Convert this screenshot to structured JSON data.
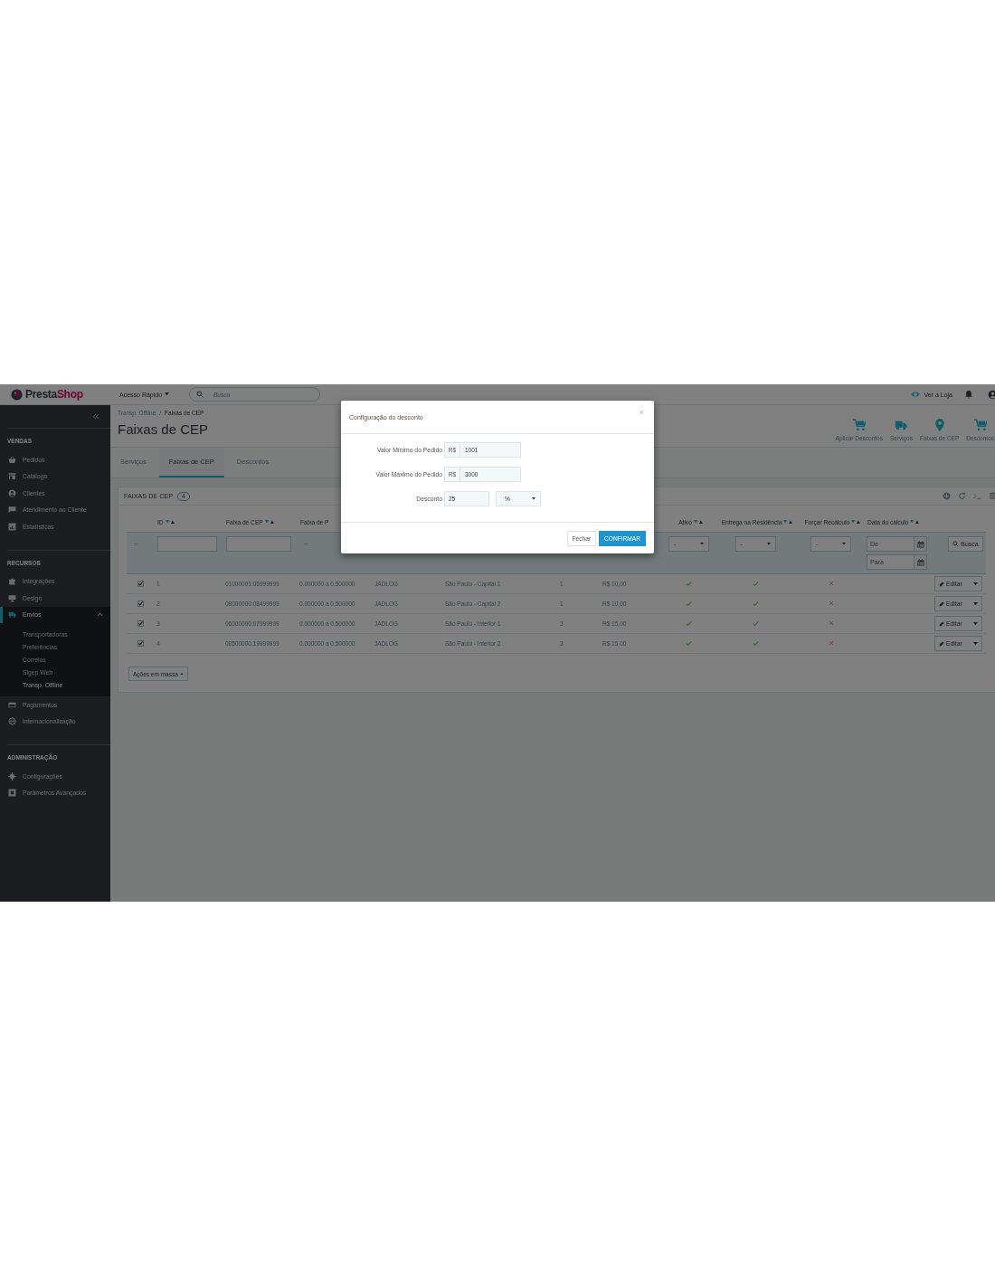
{
  "header": {
    "logo": {
      "first": "Presta",
      "second": "Shop"
    },
    "quick_access": "Acesso Rápido",
    "search": {
      "placeholder": "Busca"
    },
    "store_link": "Ver a Loja"
  },
  "sidebar": {
    "sections": [
      {
        "title": "VENDAS",
        "items": [
          {
            "label": "Pedidos",
            "selected": false,
            "expanded": false
          },
          {
            "label": "Catálogo",
            "selected": false,
            "expanded": false
          },
          {
            "label": "Clientes",
            "selected": false,
            "expanded": false
          },
          {
            "label": "Atendimento ao Cliente",
            "selected": false,
            "expanded": false
          },
          {
            "label": "Estatísticas",
            "selected": false,
            "expanded": false
          }
        ]
      },
      {
        "title": "RECURSOS",
        "items": [
          {
            "label": "Integrações",
            "selected": false,
            "expanded": false
          },
          {
            "label": "Design",
            "selected": false,
            "expanded": false
          },
          {
            "label": "Envios",
            "selected": true,
            "expanded": true,
            "children": [
              {
                "label": "Transportadoras",
                "selected": false
              },
              {
                "label": "Preferências",
                "selected": false
              },
              {
                "label": "Correios",
                "selected": false
              },
              {
                "label": "Sigep Web",
                "selected": false
              },
              {
                "label": "Transp. Offline",
                "selected": true
              }
            ]
          },
          {
            "label": "Pagamentos",
            "selected": false,
            "expanded": false
          },
          {
            "label": "Internacionalização",
            "selected": false,
            "expanded": false
          }
        ]
      },
      {
        "title": "ADMINISTRAÇÃO",
        "items": [
          {
            "label": "Configurações",
            "selected": false,
            "expanded": false
          },
          {
            "label": "Parâmetros Avançados",
            "selected": false,
            "expanded": false
          }
        ]
      }
    ]
  },
  "page": {
    "breadcrumb": {
      "items": [
        "Transp. Offline",
        "Faixas de CEP"
      ],
      "separator": "/"
    },
    "title": "Faixas de CEP",
    "toolbar": [
      "Aplicar Descontos",
      "Serviços",
      "Faixas de CEP",
      "Descontos"
    ],
    "tabs": [
      {
        "label": "Serviços",
        "selected": false
      },
      {
        "label": "Faixas de CEP",
        "selected": true
      },
      {
        "label": "Descontos",
        "selected": false
      }
    ]
  },
  "panel": {
    "title": "FAIXAS DE CEP",
    "count": "4",
    "selection": {
      "filter": {
        "kind": "text",
        "text": "--"
      }
    },
    "columns": [
      {
        "kind": "text",
        "label": "ID",
        "sortable": true,
        "filter": {
          "kind": "input"
        }
      },
      {
        "kind": "text",
        "label": "Faixa de CEP",
        "sortable": true,
        "filter": {
          "kind": "input"
        }
      },
      {
        "kind": "text",
        "label": "Faixa de P",
        "sortable": false,
        "filter": {
          "kind": "text",
          "text": "--"
        }
      },
      {
        "kind": "text"
      },
      {
        "kind": "text"
      },
      {
        "kind": "text"
      },
      {
        "kind": "text"
      },
      {
        "kind": "flag",
        "label": "Ativo",
        "sortable": true,
        "filter": {
          "kind": "select",
          "value": "-"
        }
      },
      {
        "kind": "flag",
        "label": "Entrega na Residência",
        "sortable": true,
        "filter": {
          "kind": "select",
          "value": "-"
        }
      },
      {
        "kind": "flag",
        "label": "Forçar Recálculo",
        "sortable": true,
        "filter": {
          "kind": "select",
          "value": "-"
        }
      },
      {
        "kind": "date",
        "label": "Data do cálculo",
        "sortable": true,
        "filter": {
          "kind": "date_range",
          "from_placeholder": "De",
          "to_placeholder": "Para"
        }
      },
      {
        "kind": "actions",
        "filter": {
          "kind": "button",
          "label": "Busca"
        }
      }
    ],
    "rows": [
      {
        "checked": true,
        "cells": [
          "1",
          "01000001:05999999",
          "0.000000 a 0.500000",
          "JADLOG",
          "São Paulo - Capital 1",
          "1",
          "R$ 10,00"
        ],
        "flags": [
          true,
          true,
          false
        ],
        "action": "Editar"
      },
      {
        "checked": true,
        "cells": [
          "2",
          "08000000:08499999",
          "0.000000 a 0.500000",
          "JADLOG",
          "São Paulo - Capital 2",
          "1",
          "R$ 10,00"
        ],
        "flags": [
          true,
          true,
          false
        ],
        "action": "Editar"
      },
      {
        "checked": true,
        "cells": [
          "3",
          "06000000:07999999",
          "0.000000 a 0.500000",
          "JADLOG",
          "São Paulo - Interior 1",
          "3",
          "R$ 15,00"
        ],
        "flags": [
          true,
          true,
          false
        ],
        "action": "Editar"
      },
      {
        "checked": true,
        "cells": [
          "4",
          "08500000:19999999",
          "0.000000 a 0.500000",
          "JADLOG",
          "São Paulo - Interior 2",
          "3",
          "R$ 15,00"
        ],
        "flags": [
          true,
          true,
          false
        ],
        "action": "Editar"
      }
    ],
    "bulk_actions": "Ações em massa"
  },
  "modal": {
    "title": "Configuração do desconto",
    "close": "×",
    "fields": [
      {
        "kind": "money",
        "label": "Valor Mínimo do Pedido",
        "prefix": "R$",
        "value": "1001"
      },
      {
        "kind": "money",
        "label": "Valor Máximo do Pedido",
        "prefix": "R$",
        "value": "3000"
      },
      {
        "kind": "amount",
        "label": "Desconto",
        "value": "25",
        "unit": "%"
      }
    ],
    "buttons": [
      {
        "kind": "default",
        "label": "Fechar"
      },
      {
        "kind": "primary",
        "label": "CONFIRMAR"
      }
    ]
  }
}
